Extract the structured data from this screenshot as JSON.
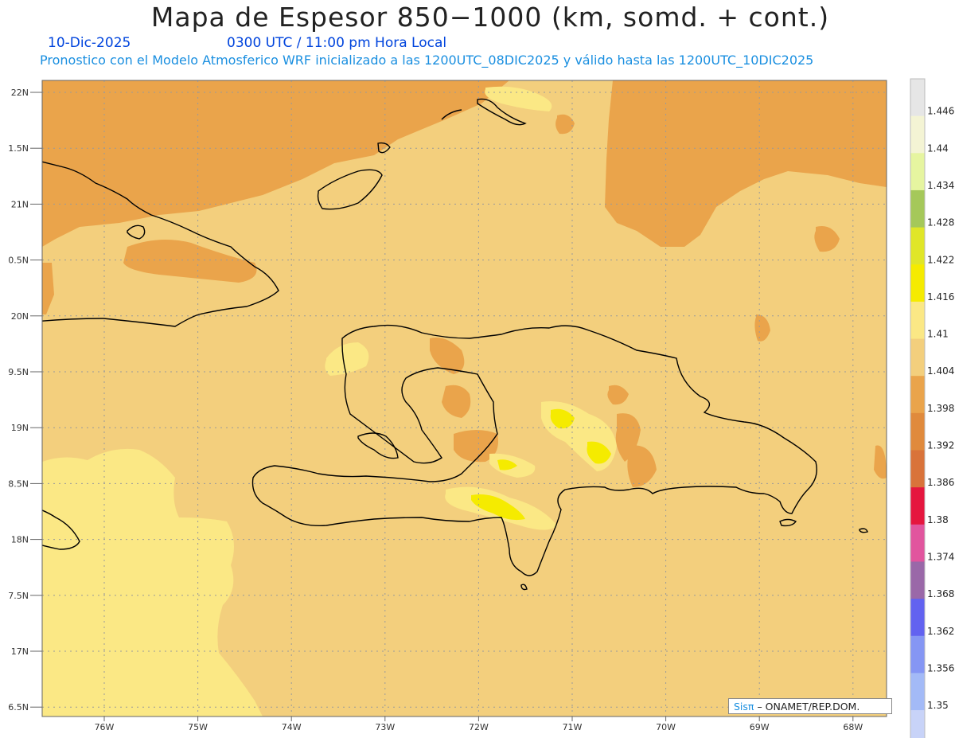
{
  "header": {
    "title": "Mapa de Espesor 850−1000 (km, somd. + cont.)",
    "date": "10-Dic-2025",
    "time": "0300 UTC / 11:00 pm Hora Local",
    "forecast": "Pronostico con el Modelo Atmosferico WRF inicializado a las 1200UTC_08DIC2025 y válido hasta las  1200UTC_10DIC2025"
  },
  "axes": {
    "lat_labels": [
      "22N",
      "1.5N",
      "21N",
      "0.5N",
      "20N",
      "9.5N",
      "19N",
      "8.5N",
      "18N",
      "7.5N",
      "17N",
      "6.5N"
    ],
    "lon_labels": [
      "76W",
      "75W",
      "74W",
      "73W",
      "72W",
      "71W",
      "70W",
      "69W",
      "68W"
    ]
  },
  "legend": {
    "labels": [
      "1.446",
      "1.44",
      "1.434",
      "1.428",
      "1.422",
      "1.416",
      "1.41",
      "1.404",
      "1.398",
      "1.392",
      "1.386",
      "1.38",
      "1.374",
      "1.368",
      "1.362",
      "1.356",
      "1.35"
    ],
    "colors": [
      "#e6e6e6",
      "#f4f4d4",
      "#e6f5a0",
      "#a5c85a",
      "#e0e628",
      "#f5eb00",
      "#fbe885",
      "#f3cf7d",
      "#eaa44b",
      "#e08a3c",
      "#d9733a",
      "#e5163e",
      "#e1559e",
      "#9a68a8",
      "#6262f0",
      "#8596f4",
      "#a3baf7",
      "#c8d3f8"
    ]
  },
  "map": {
    "colors": {
      "base": "#f3cf7d",
      "warm": "#eaa44b",
      "light": "#fbe885",
      "yellow": "#f5eb00",
      "coast": "#000000",
      "grid": "#9a9a9a"
    }
  },
  "credit": {
    "sis": "Sisπ",
    "text": "– ONAMET/REP.DOM."
  }
}
